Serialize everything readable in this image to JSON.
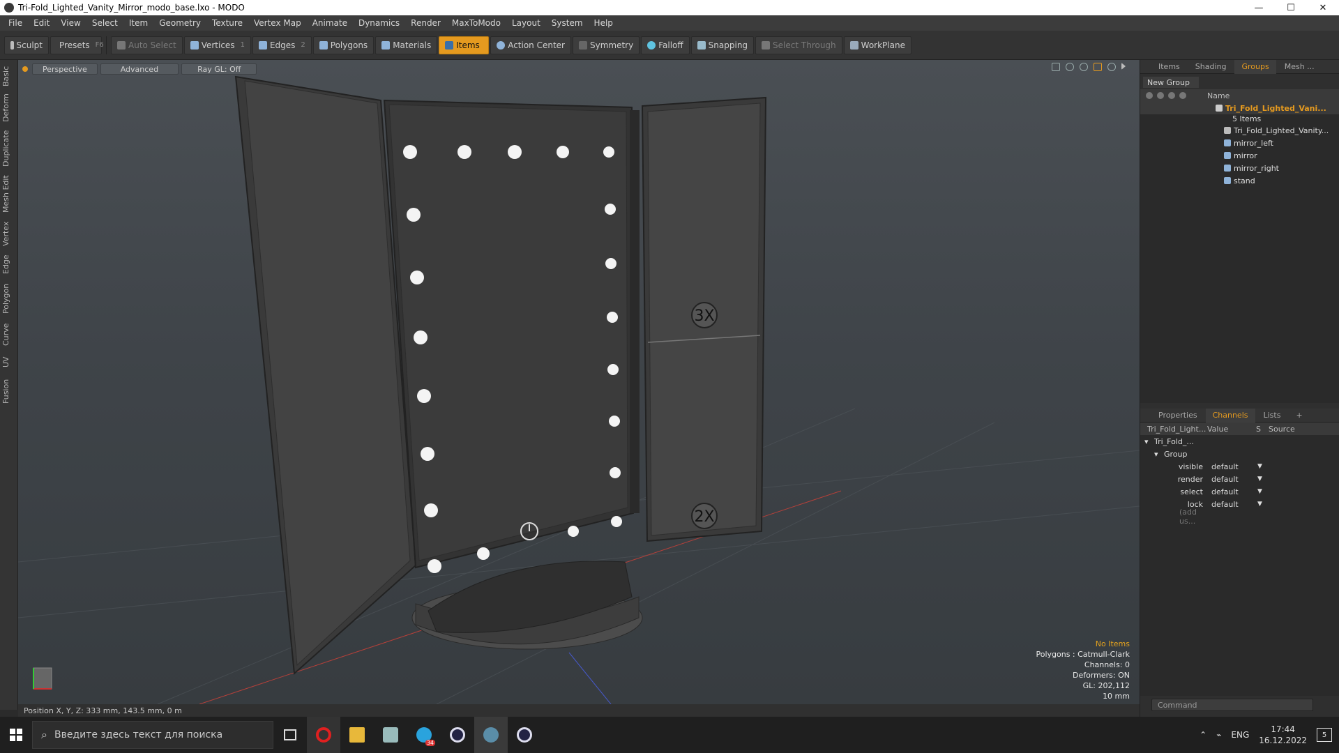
{
  "window": {
    "title": "Tri-Fold_Lighted_Vanity_Mirror_modo_base.lxo - MODO",
    "minimize": "—",
    "maximize": "☐",
    "close": "✕"
  },
  "menu": [
    "File",
    "Edit",
    "View",
    "Select",
    "Item",
    "Geometry",
    "Texture",
    "Vertex Map",
    "Animate",
    "Dynamics",
    "Render",
    "MaxToModo",
    "Layout",
    "System",
    "Help"
  ],
  "toolbar": {
    "sculpt": "Sculpt",
    "presets": "Presets",
    "presets_key": "F6",
    "auto_select": "Auto Select",
    "vertices": "Vertices",
    "vertices_key": "1",
    "edges": "Edges",
    "edges_key": "2",
    "polygons": "Polygons",
    "materials": "Materials",
    "items": "Items",
    "action_center": "Action Center",
    "symmetry": "Symmetry",
    "falloff": "Falloff",
    "snapping": "Snapping",
    "select_through": "Select Through",
    "workplane": "WorkPlane"
  },
  "left_tabs": [
    "Basic",
    "Deform",
    "Duplicate",
    "Mesh Edit",
    "Vertex",
    "Edge",
    "Polygon",
    "Curve",
    "UV",
    "Fusion"
  ],
  "viewport": {
    "view_mode": "Perspective",
    "shading": "Advanced",
    "raygl": "Ray GL: Off",
    "mirror_labels": {
      "top": "3X",
      "bottom": "2X"
    },
    "hud": {
      "selection": "No Items",
      "polygons": "Polygons : Catmull-Clark",
      "channels": "Channels: 0",
      "deformers": "Deformers: ON",
      "gl": "GL: 202,112",
      "grid": "10 mm"
    }
  },
  "status": {
    "position": "Position X, Y, Z:   333 mm, 143.5 mm, 0 m"
  },
  "groups_panel": {
    "tabs": [
      "Items",
      "Shading",
      "Groups",
      "Mesh ..."
    ],
    "active_tab": "Groups",
    "new_group": "New Group",
    "name_header": "Name",
    "group_name": "Tri_Fold_Lighted_Vani...",
    "item_count": "5 Items",
    "children": [
      "Tri_Fold_Lighted_Vanity...",
      "mirror_left",
      "mirror",
      "mirror_right",
      "stand"
    ]
  },
  "channels_panel": {
    "tabs": [
      "Properties",
      "Channels",
      "Lists",
      "+"
    ],
    "active_tab": "Channels",
    "headers": [
      "Tri_Fold_Light...",
      "Value",
      "S",
      "Source"
    ],
    "root": "Tri_Fold_...",
    "group": "Group",
    "rows": [
      {
        "name": "visible",
        "value": "default"
      },
      {
        "name": "render",
        "value": "default"
      },
      {
        "name": "select",
        "value": "default"
      },
      {
        "name": "lock",
        "value": "default"
      }
    ],
    "add_user": "(add us..."
  },
  "command": {
    "placeholder": "Command"
  },
  "taskbar": {
    "search_placeholder": "Введите здесь текст для поиска",
    "telegram_badge": "34",
    "language": "ENG",
    "time": "17:44",
    "date": "16.12.2022",
    "notifications": "5"
  },
  "colors": {
    "accent": "#e59a1f",
    "viewport_bg": "#434850",
    "panel_bg": "#2a2a2a"
  }
}
